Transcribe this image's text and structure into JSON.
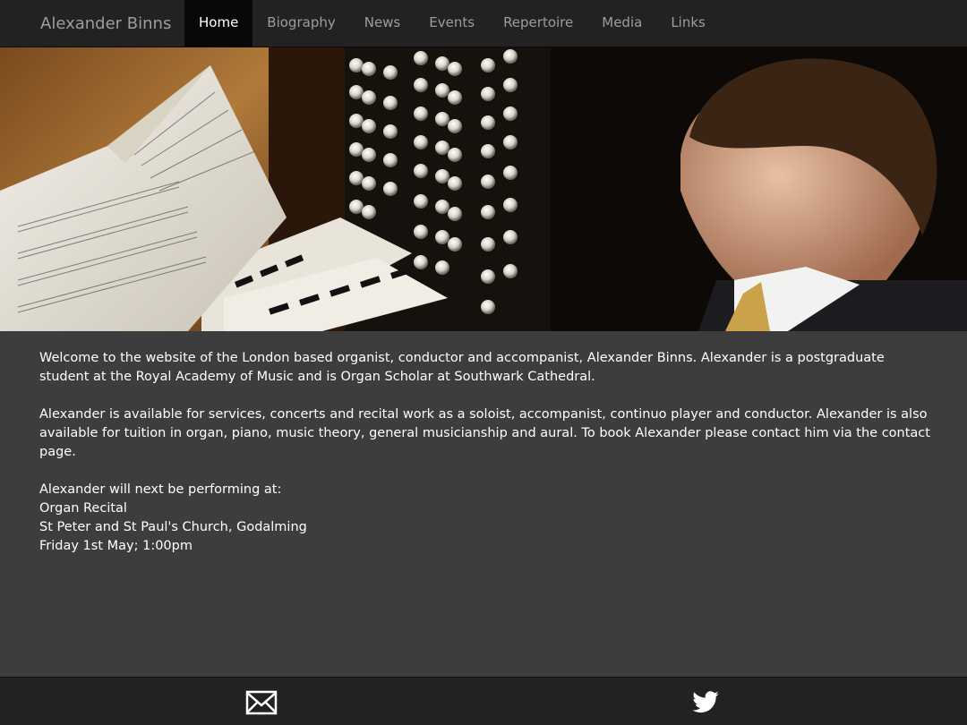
{
  "navbar": {
    "brand": "Alexander Binns",
    "items": [
      {
        "label": "Home",
        "active": true
      },
      {
        "label": "Biography",
        "active": false
      },
      {
        "label": "News",
        "active": false
      },
      {
        "label": "Events",
        "active": false
      },
      {
        "label": "Repertoire",
        "active": false
      },
      {
        "label": "Media",
        "active": false
      },
      {
        "label": "Links",
        "active": false
      }
    ]
  },
  "hero": {
    "image": "organist-at-console-photo"
  },
  "main": {
    "intro": "Welcome to the website of the London based organist, conductor and accompanist, Alexander Binns. Alexander is a postgraduate student at the Royal Academy of Music and is Organ Scholar at Southwark Cathedral.",
    "availability": "Alexander is available for services, concerts and recital work as a soloist, accompanist, continuo player and conductor. Alexander is also available for tuition in organ, piano, music theory, general musicianship and aural. To book Alexander please contact him via the contact page.",
    "next_performance": {
      "heading": "Alexander will next be performing at:",
      "event": "Organ Recital",
      "venue": "St Peter and St Paul's Church, Godalming",
      "datetime": "Friday 1st May; 1:00pm"
    }
  },
  "footer": {
    "icons": [
      "envelope-icon",
      "twitter-icon"
    ]
  },
  "colors": {
    "navbar_bg": "#222222",
    "active_tab_bg": "#080808",
    "page_bg": "#3d3d3d",
    "text": "#ffffff",
    "nav_text": "#9d9d9d"
  }
}
